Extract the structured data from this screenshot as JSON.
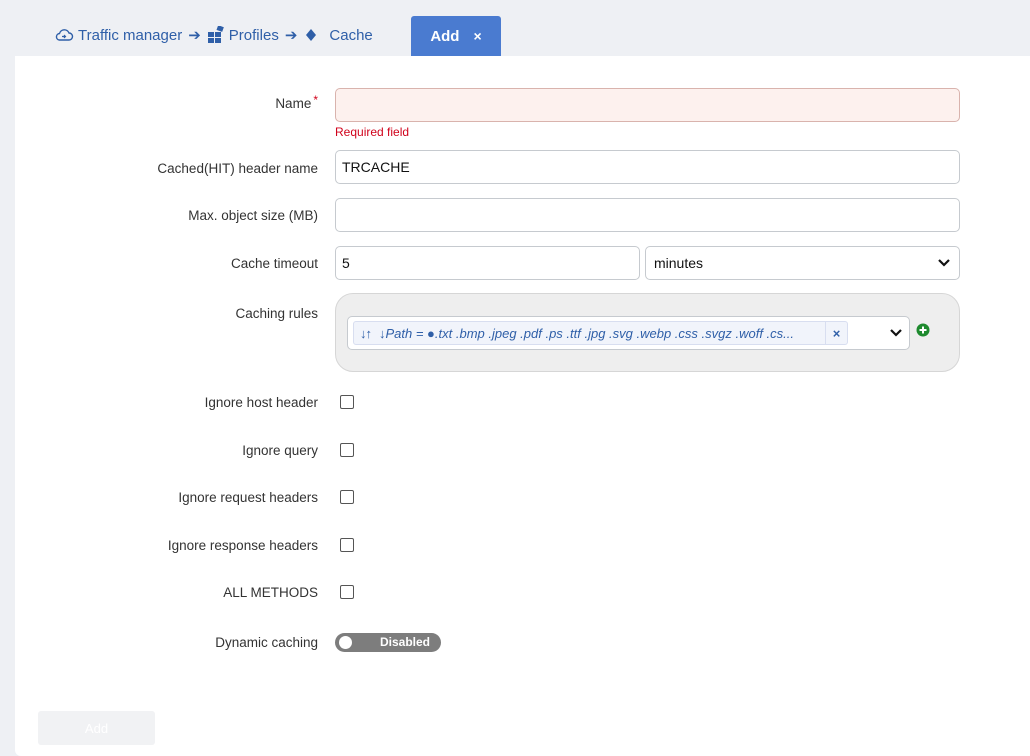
{
  "breadcrumb": {
    "items": [
      {
        "label": "Traffic manager",
        "icon": "cloud-icon"
      },
      {
        "label": "Profiles",
        "icon": "profiles-grid-icon"
      },
      {
        "label": "Cache",
        "icon": "diamond-icon"
      }
    ]
  },
  "active_tab": {
    "label": "Add",
    "close": "×"
  },
  "form": {
    "name": {
      "label": "Name",
      "required_mark": "*",
      "value": "",
      "error": "Required field"
    },
    "cached_header": {
      "label": "Cached(HIT) header name",
      "value": "TRCACHE"
    },
    "max_object_size": {
      "label": "Max. object size (MB)",
      "value": ""
    },
    "cache_timeout": {
      "label": "Cache timeout",
      "value": "5",
      "unit": "minutes"
    },
    "caching_rules": {
      "label": "Caching rules",
      "rule_sort": "↓↑",
      "rule_text": "↓Path = ●.txt .bmp .jpeg .pdf .ps .ttf .jpg .svg .webp .css .svgz .woff .cs...",
      "rule_remove": "×"
    },
    "ignore_host_header": {
      "label": "Ignore host header",
      "checked": false
    },
    "ignore_query": {
      "label": "Ignore query",
      "checked": false
    },
    "ignore_request_headers": {
      "label": "Ignore request headers",
      "checked": false
    },
    "ignore_response_headers": {
      "label": "Ignore response headers",
      "checked": false
    },
    "all_methods": {
      "label": "ALL METHODS",
      "checked": false
    },
    "dynamic_caching": {
      "label": "Dynamic caching",
      "state": "Disabled"
    }
  },
  "footer": {
    "add_label": "Add"
  },
  "colors": {
    "accent": "#4a7bd0",
    "link": "#2f5fa8",
    "error": "#d0021b",
    "add_green": "#1e8a2e"
  }
}
